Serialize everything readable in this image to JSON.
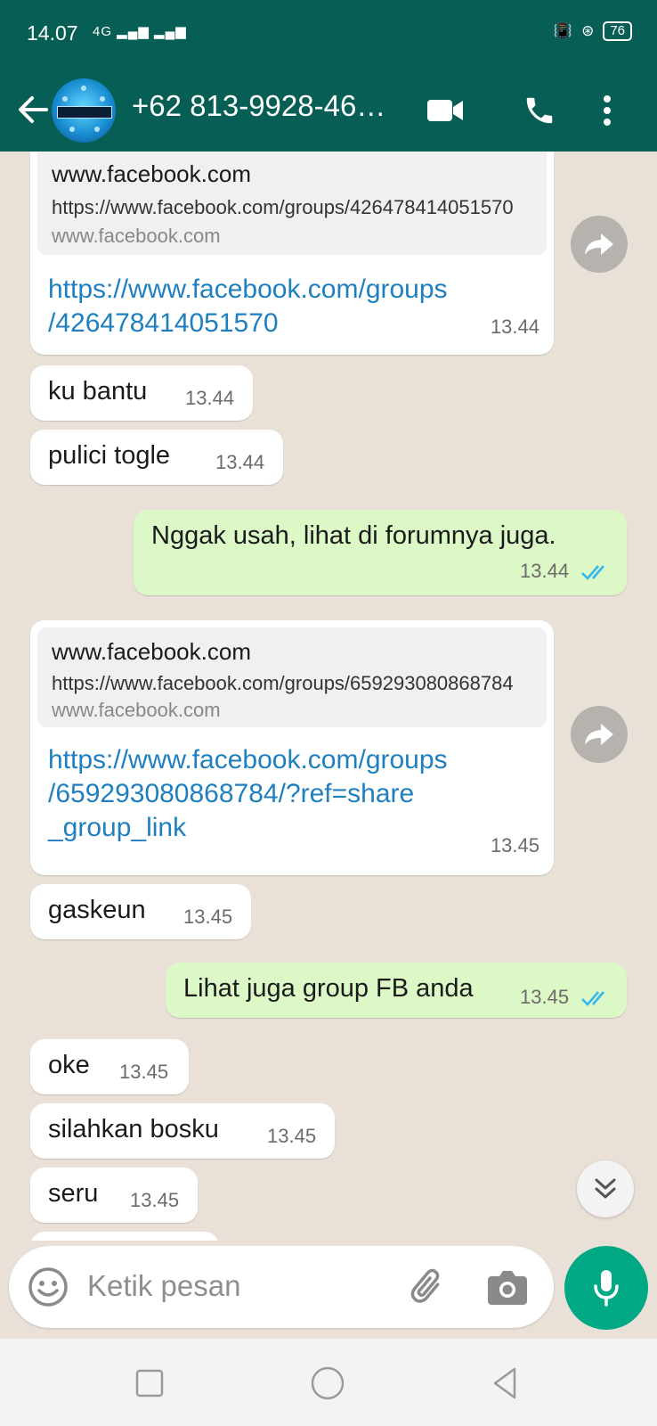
{
  "status": {
    "time": "14.07",
    "network": "4G",
    "battery": "76"
  },
  "header": {
    "contact_name": "+62 813-9928-46…",
    "avatar_text": "EVOSTETE",
    "colors": {
      "bar": "#075e54",
      "accent": "#00a884",
      "outgoing": "#dcf8c6",
      "link": "#1f7fbf",
      "read_ticks": "#34b7f1"
    }
  },
  "messages": [
    {
      "direction": "in",
      "preview": {
        "title": "www.facebook.com",
        "url": "https://www.facebook.com/groups/426478414051570",
        "domain": "www.facebook.com"
      },
      "link_lines": [
        "https://www.facebook.com/groups",
        "/426478414051570"
      ],
      "time": "13.44"
    },
    {
      "direction": "in",
      "text": "ku bantu",
      "time": "13.44"
    },
    {
      "direction": "in",
      "text": "pulici togle",
      "time": "13.44"
    },
    {
      "direction": "out",
      "text": "Nggak usah, lihat di forumnya juga.",
      "time": "13.44",
      "status": "read"
    },
    {
      "direction": "in",
      "preview": {
        "title": "www.facebook.com",
        "url": "https://www.facebook.com/groups/659293080868784",
        "domain": "www.facebook.com"
      },
      "link_lines": [
        "https://www.facebook.com/groups",
        "/659293080868784/?ref=share",
        "_group_link"
      ],
      "time": "13.45"
    },
    {
      "direction": "in",
      "text": "gaskeun",
      "time": "13.45"
    },
    {
      "direction": "out",
      "text": "Lihat juga group FB anda",
      "time": "13.45",
      "status": "read"
    },
    {
      "direction": "in",
      "text": "oke",
      "time": "13.45"
    },
    {
      "direction": "in",
      "text": "silahkan bosku",
      "time": "13.45"
    },
    {
      "direction": "in",
      "text": "seru",
      "time": "13.45"
    }
  ],
  "composer": {
    "placeholder": "Ketik pesan"
  },
  "icons": [
    "back-arrow-icon",
    "video-call-icon",
    "voice-call-icon",
    "more-vert-icon",
    "forward-icon",
    "double-chevron-down-icon",
    "emoji-icon",
    "attach-icon",
    "camera-icon",
    "mic-icon",
    "nav-recents-icon",
    "nav-home-icon",
    "nav-back-icon"
  ]
}
